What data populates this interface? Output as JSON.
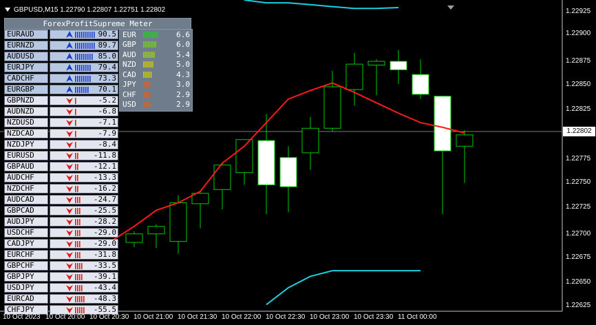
{
  "header": {
    "symbol_info": "GBPUSD,M15  1.22790 1.22807 1.22751 1.22802"
  },
  "meter": {
    "title": "ForexProfitSupreme Meter",
    "pairs": [
      {
        "name": "EURAUD",
        "value": "90.5",
        "dir": "up",
        "bars": 10
      },
      {
        "name": "EURNZD",
        "value": "89.7",
        "dir": "up",
        "bars": 10
      },
      {
        "name": "AUDUSD",
        "value": "85.0",
        "dir": "up",
        "bars": 9
      },
      {
        "name": "EURJPY",
        "value": "79.4",
        "dir": "up",
        "bars": 8
      },
      {
        "name": "CADCHF",
        "value": "73.3",
        "dir": "up",
        "bars": 8
      },
      {
        "name": "EURGBP",
        "value": "70.1",
        "dir": "up",
        "bars": 7
      },
      {
        "name": "GBPNZD",
        "value": "-5.2",
        "dir": "down",
        "bars": 1
      },
      {
        "name": "AUDNZD",
        "value": "-6.8",
        "dir": "down",
        "bars": 1
      },
      {
        "name": "NZDUSD",
        "value": "-7.1",
        "dir": "down",
        "bars": 1
      },
      {
        "name": "NZDCAD",
        "value": "-7.9",
        "dir": "down",
        "bars": 1
      },
      {
        "name": "NZDJPY",
        "value": "-8.4",
        "dir": "down",
        "bars": 1
      },
      {
        "name": "EURUSD",
        "value": "-11.8",
        "dir": "down",
        "bars": 2
      },
      {
        "name": "GBPAUD",
        "value": "-12.1",
        "dir": "down",
        "bars": 2
      },
      {
        "name": "AUDCHF",
        "value": "-13.3",
        "dir": "down",
        "bars": 2
      },
      {
        "name": "NZDCHF",
        "value": "-16.2",
        "dir": "down",
        "bars": 2
      },
      {
        "name": "AUDCAD",
        "value": "-24.7",
        "dir": "down",
        "bars": 3
      },
      {
        "name": "GBPCAD",
        "value": "-25.5",
        "dir": "down",
        "bars": 3
      },
      {
        "name": "AUDJPY",
        "value": "-28.2",
        "dir": "down",
        "bars": 3
      },
      {
        "name": "USDCHF",
        "value": "-29.0",
        "dir": "down",
        "bars": 3
      },
      {
        "name": "CADJPY",
        "value": "-29.0",
        "dir": "down",
        "bars": 3
      },
      {
        "name": "EURCHF",
        "value": "-31.8",
        "dir": "down",
        "bars": 3
      },
      {
        "name": "GBPCHF",
        "value": "-33.5",
        "dir": "down",
        "bars": 4
      },
      {
        "name": "GBPJPY",
        "value": "-39.1",
        "dir": "down",
        "bars": 4
      },
      {
        "name": "USDJPY",
        "value": "-43.4",
        "dir": "down",
        "bars": 4
      },
      {
        "name": "EURCAD",
        "value": "-48.3",
        "dir": "down",
        "bars": 5
      },
      {
        "name": "CHFJPY",
        "value": "-55.5",
        "dir": "down",
        "bars": 5
      }
    ],
    "currencies": [
      {
        "name": "EUR",
        "value": "6.6",
        "bars": 10,
        "color": "#22cc22"
      },
      {
        "name": "GBP",
        "value": "6.0",
        "bars": 9,
        "color": "#77cc22"
      },
      {
        "name": "AUD",
        "value": "5.4",
        "bars": 8,
        "color": "#99cc22"
      },
      {
        "name": "NZD",
        "value": "5.0",
        "bars": 7,
        "color": "#cccc00"
      },
      {
        "name": "CAD",
        "value": "4.3",
        "bars": 6,
        "color": "#cccc00"
      },
      {
        "name": "JPY",
        "value": "3.0",
        "bars": 5,
        "color": "#e0601a"
      },
      {
        "name": "CHF",
        "value": "2.9",
        "bars": 5,
        "color": "#e0601a"
      },
      {
        "name": "USD",
        "value": "2.9",
        "bars": 5,
        "color": "#e0601a"
      }
    ]
  },
  "price_axis": {
    "labels": [
      "1.22925",
      "1.22900",
      "1.22875",
      "1.22850",
      "1.22825",
      "1.22775",
      "1.22750",
      "1.22725",
      "1.22700",
      "1.22675",
      "1.22650",
      "1.22625"
    ],
    "current": "1.22802"
  },
  "time_axis": {
    "labels": [
      "10 Oct 2023",
      "10 Oct 20:00",
      "10 Oct 20:30",
      "10 Oct 21:00",
      "10 Oct 21:30",
      "10 Oct 22:00",
      "10 Oct 22:30",
      "10 Oct 23:00",
      "10 Oct 23:30",
      "11 Oct 00:00"
    ]
  },
  "colors": {
    "bull_candle": "#00cc00",
    "bear_body": "#ffffff",
    "ma_line": "#ff1a1a",
    "band_line": "#1ad0e0",
    "arrow_up": "#1a3cc8",
    "arrow_down": "#e01a1a",
    "bar_up": "#1a3cc8",
    "bar_down": "#e01a1a"
  },
  "chart_data": {
    "type": "candlestick",
    "timeframe": "M15",
    "ylim": [
      1.22615,
      1.22945
    ],
    "candles": [
      {
        "o": 1.22688,
        "h": 1.227,
        "l": 1.22683,
        "c": 1.22697
      },
      {
        "o": 1.22697,
        "h": 1.22707,
        "l": 1.22682,
        "c": 1.22705
      },
      {
        "o": 1.22689,
        "h": 1.22738,
        "l": 1.22676,
        "c": 1.2273
      },
      {
        "o": 1.22729,
        "h": 1.22741,
        "l": 1.22703,
        "c": 1.2274
      },
      {
        "o": 1.22744,
        "h": 1.22772,
        "l": 1.22723,
        "c": 1.2277
      },
      {
        "o": 1.22762,
        "h": 1.22797,
        "l": 1.22749,
        "c": 1.22797
      },
      {
        "o": 1.22796,
        "h": 1.22824,
        "l": 1.22718,
        "c": 1.22749
      },
      {
        "o": 1.22778,
        "h": 1.2279,
        "l": 1.2272,
        "c": 1.22747
      },
      {
        "o": 1.22783,
        "h": 1.22821,
        "l": 1.22765,
        "c": 1.22809
      },
      {
        "o": 1.22809,
        "h": 1.2287,
        "l": 1.22806,
        "c": 1.22853
      },
      {
        "o": 1.2285,
        "h": 1.22889,
        "l": 1.22833,
        "c": 1.22877
      },
      {
        "o": 1.22876,
        "h": 1.22882,
        "l": 1.22844,
        "c": 1.2288
      },
      {
        "o": 1.2288,
        "h": 1.22892,
        "l": 1.22856,
        "c": 1.22871
      },
      {
        "o": 1.22866,
        "h": 1.22882,
        "l": 1.2284,
        "c": 1.22845
      },
      {
        "o": 1.22843,
        "h": 1.22843,
        "l": 1.22718,
        "c": 1.22785
      },
      {
        "o": 1.2279,
        "h": 1.22807,
        "l": 1.22751,
        "c": 1.22802
      }
    ],
    "ma": [
      1.2269,
      1.22705,
      1.22722,
      1.2273,
      1.22742,
      1.22772,
      1.2279,
      1.22815,
      1.2284,
      1.22849,
      1.22857,
      1.22847,
      1.22836,
      1.22825,
      1.22815,
      1.2281,
      1.22804
    ],
    "upper_band": [
      1.22945,
      1.22942,
      1.22942,
      1.2294,
      1.22938,
      1.22936,
      1.22936,
      1.22937
    ],
    "lower_band": [
      1.22622,
      1.2264,
      1.22652,
      1.22658,
      1.22658,
      1.22658,
      1.22658,
      1.22658
    ]
  }
}
